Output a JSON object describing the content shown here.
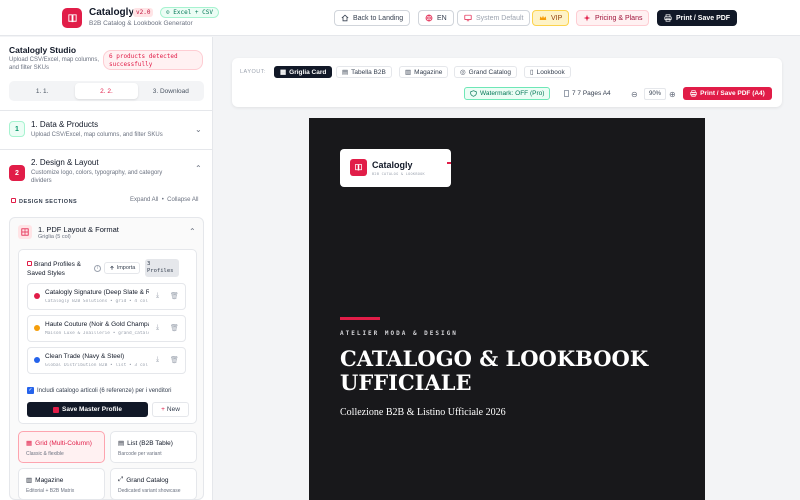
{
  "header": {
    "app_name": "Catalogly",
    "version": "v2.0",
    "format_badge": "Excel + CSV",
    "subtitle": "B2B Catalog & Lookbook Generator",
    "back_label": "Back to Landing",
    "lang_label": "EN",
    "theme_label": "System Default",
    "vip_label": "VIP",
    "pricing_label": "Pricing & Plans",
    "print_label": "Print / Save PDF"
  },
  "sidebar": {
    "title": "Catalogly Studio",
    "subtitle": "Upload CSV/Excel, map columns, and filter SKUs",
    "detect_badge": "6 products detected successfully",
    "steps": [
      "1. 1.",
      "2. 2.",
      "3. Download"
    ],
    "sections": [
      {
        "num": "1",
        "title": "1. Data & Products",
        "subtitle": "Upload CSV/Excel, map columns, and filter SKUs"
      },
      {
        "num": "2",
        "title": "2. Design & Layout",
        "subtitle": "Customize logo, colors, typography, and category dividers"
      }
    ],
    "design_sections_label": "DESIGN SECTIONS",
    "expand_all": "Expand All",
    "bullet": "•",
    "collapse_all": "Collapse All",
    "pdf_panel": {
      "title": "1. PDF Layout & Format",
      "subtitle": "Griglia (5 col)",
      "brand_title": "Brand Profiles & Saved Styles",
      "info_glyph": "i",
      "import_label": "Importa",
      "profile_count": "3 Profiles",
      "profiles": [
        {
          "name": "Catalogly Signature (Deep Slate & Red)",
          "desc": "Catalogly B2B Solutions • grid • 4 col",
          "color": "#e11d48"
        },
        {
          "name": "Haute Couture (Noir & Gold Champagne)",
          "desc": "Maison Luxe & Joaillerie • grand_catalog",
          "color": "#f59e0b"
        },
        {
          "name": "Clean Trade (Navy & Steel)",
          "desc": "Global Distribution B2B • list • 3 col",
          "color": "#2563eb"
        }
      ],
      "include_text": "Includi catalogo articoli (6 referenze) per i venditori",
      "save_master_label": "Save Master Profile",
      "new_label": "New",
      "layouts": [
        {
          "title": "Grid (Multi-Column)",
          "subtitle": "Classic & flexible"
        },
        {
          "title": "List (B2B Table)",
          "subtitle": "Barcode per variant"
        },
        {
          "title": "Magazine",
          "subtitle": "Editorial + B2B Matrix"
        },
        {
          "title": "Grand Catalog",
          "subtitle": "Dedicated variant showcase"
        }
      ]
    }
  },
  "toolbar": {
    "layout_label": "LAYOUT:",
    "tabs": [
      "Griglia Card",
      "Tabella B2B",
      "Magazine",
      "Grand Catalog",
      "Lookbook"
    ],
    "watermark_label": "Watermark: OFF (Pro)",
    "pages_label": "7 7 Pages A4",
    "zoom_out_glyph": "⊖",
    "zoom": "90%",
    "zoom_in_glyph": "⊕",
    "print_label": "Print / Save PDF (A4)"
  },
  "preview": {
    "logo_name": "Catalogly",
    "logo_sub": "B2B CATALOG & LOOKBOOK",
    "eyebrow": "ATELIER MODA & DESIGN",
    "title": "CATALOGO & LOOKBOOK UFFICIALE",
    "subtitle": "Collezione B2B & Listino Ufficiale 2026"
  },
  "colors": {
    "accent": "#e11d48",
    "dark": "#111827",
    "page_bg": "#18181b"
  },
  "icons": [
    "book-icon",
    "home-icon",
    "globe-icon",
    "monitor-icon",
    "crown-icon",
    "sparkle-icon",
    "printer-icon",
    "chevron-down-icon",
    "chevron-up-icon",
    "grid-icon",
    "upload-icon",
    "download-icon",
    "trash-icon",
    "save-icon",
    "plus-icon",
    "shield-icon",
    "page-icon",
    "zoom-out-icon",
    "zoom-in-icon"
  ]
}
